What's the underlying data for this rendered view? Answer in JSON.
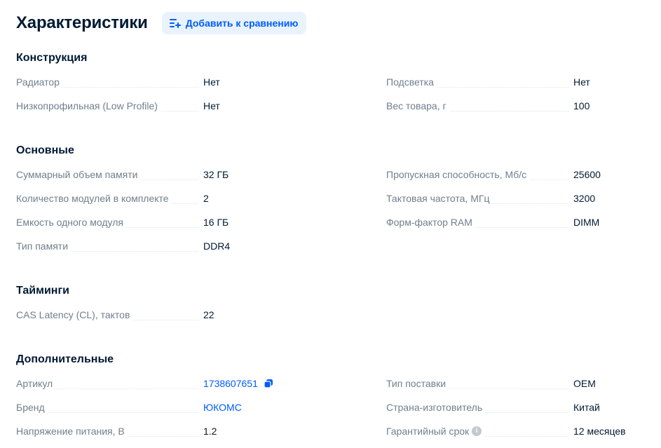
{
  "header": {
    "title": "Характеристики",
    "compare_button": "Добавить к сравнению",
    "compare_icon": "list-add-icon"
  },
  "sections": {
    "construction": {
      "title": "Конструкция",
      "radiator": {
        "label": "Радиатор",
        "value": "Нет"
      },
      "backlight": {
        "label": "Подсветка",
        "value": "Нет"
      },
      "low_profile": {
        "label": "Низкопрофильная (Low Profile)",
        "value": "Нет"
      },
      "weight": {
        "label": "Вес товара, г",
        "value": "100"
      }
    },
    "main": {
      "title": "Основные",
      "total_memory": {
        "label": "Суммарный объем памяти",
        "value": "32 ГБ"
      },
      "bandwidth": {
        "label": "Пропускная способность, Мб/с",
        "value": "25600"
      },
      "modules_count": {
        "label": "Количество модулей в комплекте",
        "value": "2"
      },
      "frequency": {
        "label": "Тактовая частота, МГц",
        "value": "3200"
      },
      "module_capacity": {
        "label": "Емкость одного модуля",
        "value": "16 ГБ"
      },
      "form_factor": {
        "label": "Форм-фактор RAM",
        "value": "DIMM"
      },
      "memory_type": {
        "label": "Тип памяти",
        "value": "DDR4"
      }
    },
    "timings": {
      "title": "Тайминги",
      "cas_latency": {
        "label": "CAS Latency (CL), тактов",
        "value": "22"
      }
    },
    "additional": {
      "title": "Дополнительные",
      "article": {
        "label": "Артикул",
        "value": "1738607651",
        "icon": "copy-icon"
      },
      "delivery_type": {
        "label": "Тип поставки",
        "value": "OEM"
      },
      "brand": {
        "label": "Бренд",
        "value": "ЮКОМС"
      },
      "country": {
        "label": "Страна-изготовитель",
        "value": "Китай"
      },
      "voltage": {
        "label": "Напряжение питания, В",
        "value": "1.2"
      },
      "warranty": {
        "label": "Гарантийный срок",
        "value": "12 месяцев",
        "info_icon": "i"
      }
    }
  },
  "colors": {
    "link": "#005bff",
    "label": "#707f8d",
    "text": "#001a34",
    "button_bg": "#e8f3fe"
  }
}
